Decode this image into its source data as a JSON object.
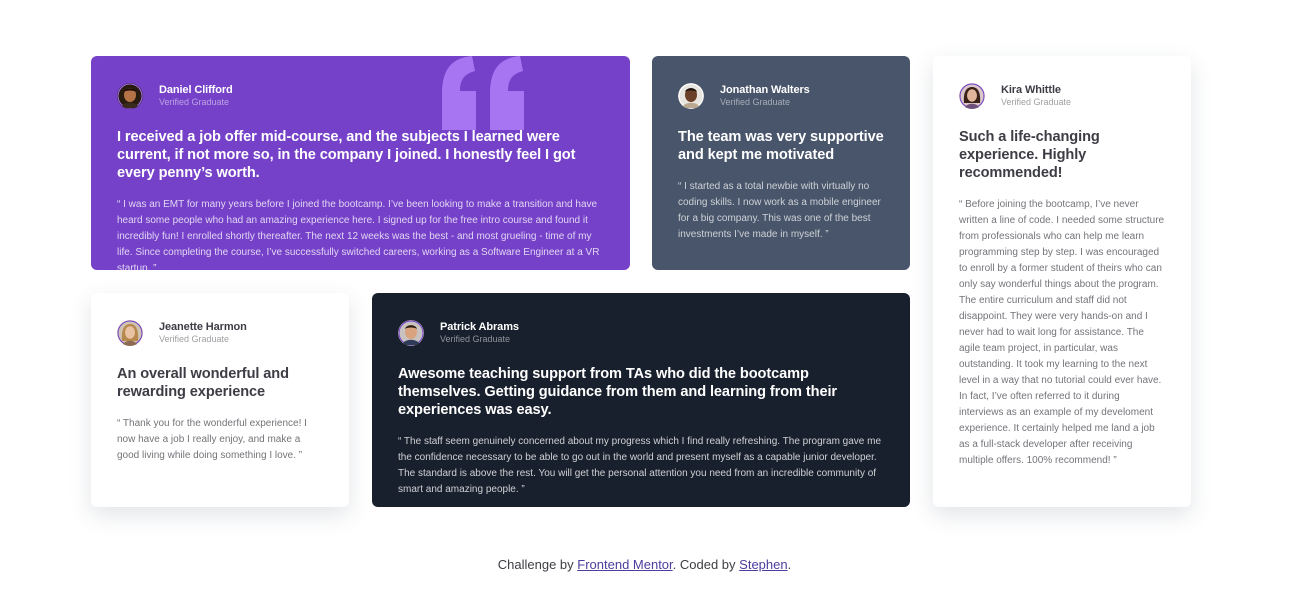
{
  "colors": {
    "purple": "#7541c8",
    "slate": "#48556a",
    "dark": "#19202d",
    "white": "#ffffff",
    "quote_mark": "#a775f1",
    "link": "#4b3e9e"
  },
  "testimonials": [
    {
      "name": "Daniel Clifford",
      "role": "Verified Graduate",
      "headline": "I received a job offer mid-course, and the subjects I learned were current, if not more so, in the company I joined. I honestly feel I got every penny’s worth.",
      "body": "“ I was an EMT for many years before I joined the bootcamp. I’ve been looking to make a transition and have heard some people who had an amazing experience here. I signed up for the free intro course and found it incredibly fun! I enrolled shortly thereafter. The next 12 weeks was the best - and most grueling - time of my life. Since completing the course, I’ve successfully switched careers, working as a Software Engineer at a VR startup. ”",
      "avatar_icon": "avatar-photo-icon"
    },
    {
      "name": "Jonathan Walters",
      "role": "Verified Graduate",
      "headline": "The team was very supportive and kept me motivated",
      "body": "“ I started as a total newbie with virtually no coding skills. I now work as a mobile engineer for a big company. This was one of the best investments I’ve made in myself. ”",
      "avatar_icon": "avatar-photo-icon"
    },
    {
      "name": "Kira Whittle",
      "role": "Verified Graduate",
      "headline": "Such a life-changing experience. Highly recommended!",
      "body": "“ Before joining the bootcamp, I’ve never written a line of code. I needed some structure from professionals who can help me learn programming step by step. I was encouraged to enroll by a former student of theirs who can only say wonderful things about the program. The entire curriculum and staff did not disappoint. They were very hands-on and I never had to wait long for assistance. The agile team project, in particular, was outstanding. It took my learning to the next level in a way that no tutorial could ever have. In fact, I’ve often referred to it during interviews as an example of my develoment experience. It certainly helped me land a job as a full-stack developer after receiving multiple offers. 100% recommend! ”",
      "avatar_icon": "avatar-photo-icon"
    },
    {
      "name": "Jeanette Harmon",
      "role": "Verified Graduate",
      "headline": "An overall wonderful and rewarding experience",
      "body": "“ Thank you for the wonderful experience! I now have a job I really enjoy, and make a good living while doing something I love. ”",
      "avatar_icon": "avatar-photo-icon"
    },
    {
      "name": "Patrick Abrams",
      "role": "Verified Graduate",
      "headline": "Awesome teaching support from TAs who did the bootcamp themselves. Getting guidance from them and learning from their experiences was easy.",
      "body": "“ The staff seem genuinely concerned about my progress which I find really refreshing. The program gave me the confidence necessary to be able to go out in the world and present myself as a capable junior developer. The standard is above the rest. You will get the personal attention you need from an incredible community of smart and amazing people. ”",
      "avatar_icon": "avatar-photo-icon"
    }
  ],
  "footer": {
    "prefix": "Challenge by ",
    "challenge_link": "Frontend Mentor",
    "middle": ". Coded by ",
    "author_link": "Stephen",
    "suffix": "."
  }
}
